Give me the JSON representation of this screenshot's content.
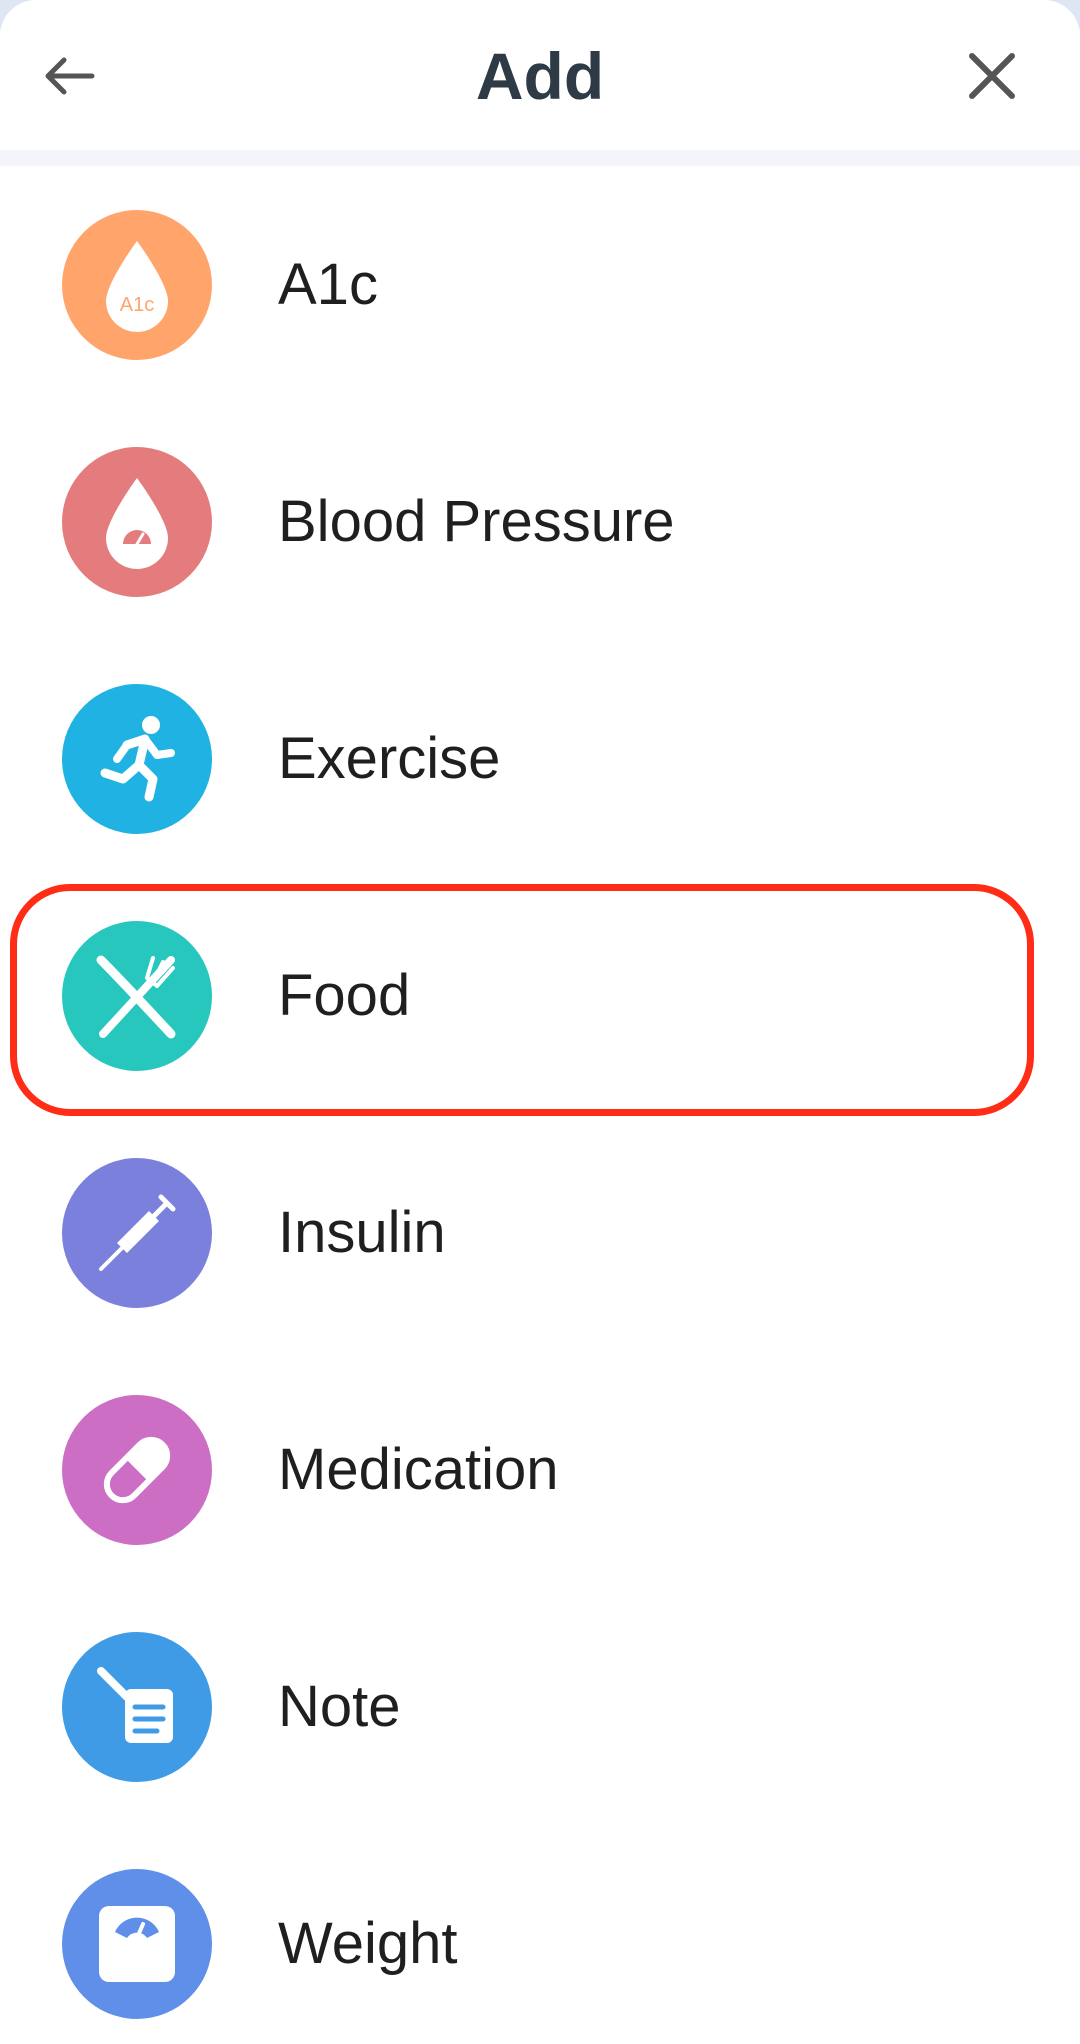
{
  "header": {
    "title": "Add",
    "back_icon": "arrow-left-icon",
    "close_icon": "close-icon"
  },
  "items": [
    {
      "label": "A1c",
      "icon": "a1c-drop-icon",
      "icon_text": "A1c",
      "color": "#ffa56b"
    },
    {
      "label": "Blood Pressure",
      "icon": "blood-pressure-drop-icon",
      "color": "#e47b7d"
    },
    {
      "label": "Exercise",
      "icon": "running-person-icon",
      "color": "#1fb2e3"
    },
    {
      "label": "Food",
      "icon": "fork-knife-icon",
      "color": "#27c7bd"
    },
    {
      "label": "Insulin",
      "icon": "syringe-icon",
      "color": "#7b80dc"
    },
    {
      "label": "Medication",
      "icon": "pill-capsule-icon",
      "color": "#cc6fc4"
    },
    {
      "label": "Note",
      "icon": "note-icon",
      "color": "#3f9be6"
    },
    {
      "label": "Weight",
      "icon": "scale-icon",
      "color": "#5f8fe8"
    }
  ],
  "highlight": {
    "item": "Food",
    "color": "#ff2d16"
  }
}
